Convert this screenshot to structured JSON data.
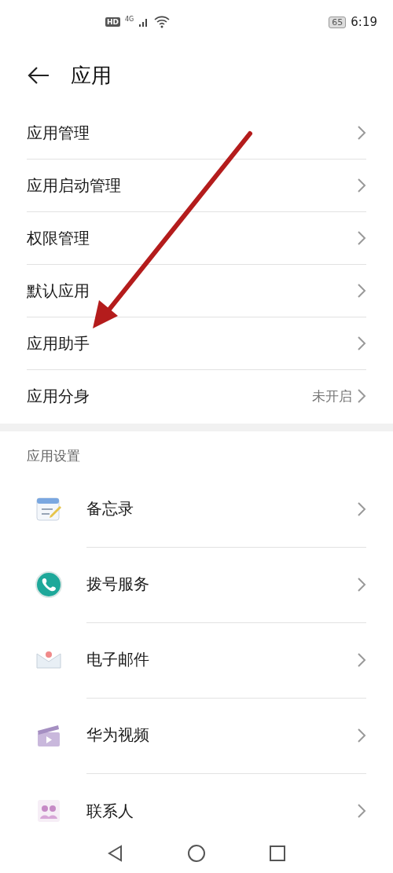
{
  "status_bar": {
    "network_badge": "HD",
    "network_type": "4G",
    "battery": "65",
    "time": "6:19"
  },
  "header": {
    "title": "应用"
  },
  "menu": [
    {
      "label": "应用管理"
    },
    {
      "label": "应用启动管理"
    },
    {
      "label": "权限管理"
    },
    {
      "label": "默认应用"
    },
    {
      "label": "应用助手"
    },
    {
      "label": "应用分身",
      "value": "未开启"
    }
  ],
  "section": {
    "title": "应用设置",
    "apps": [
      {
        "label": "备忘录"
      },
      {
        "label": "拨号服务"
      },
      {
        "label": "电子邮件"
      },
      {
        "label": "华为视频"
      },
      {
        "label": "联系人"
      }
    ]
  }
}
